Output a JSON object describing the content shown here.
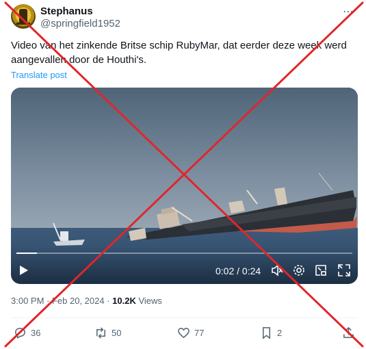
{
  "author": {
    "name": "Stephanus",
    "handle": "@springfield1952",
    "avatar_icon": "avatar-icon"
  },
  "header": {
    "more_label": "⋯"
  },
  "tweet": {
    "text_line1": "Video van het zinkende Britse schip RubyMar, dat eerder deze week werd",
    "text_line2": "aangevallen door de Houthi's.",
    "translate_label": "Translate post"
  },
  "video": {
    "time_current": "0:02",
    "time_separator": " / ",
    "time_total": "0:24",
    "progress_fraction": 0.062,
    "icons": [
      "play-icon",
      "mute-icon",
      "settings-icon",
      "pip-icon",
      "fullscreen-icon"
    ]
  },
  "meta": {
    "time": "3:00 PM",
    "dot": " · ",
    "date": "Feb 20, 2024",
    "dot2": " · ",
    "views_count": "10.2K",
    "views_label": " Views"
  },
  "actions": {
    "replies": "36",
    "reposts": "50",
    "likes": "77",
    "bookmarks": "2"
  },
  "overlay": {
    "cross_color": "#e0262b"
  },
  "colors": {
    "accent": "#1d9bf0",
    "muted": "#536471",
    "text": "#0f1419"
  }
}
